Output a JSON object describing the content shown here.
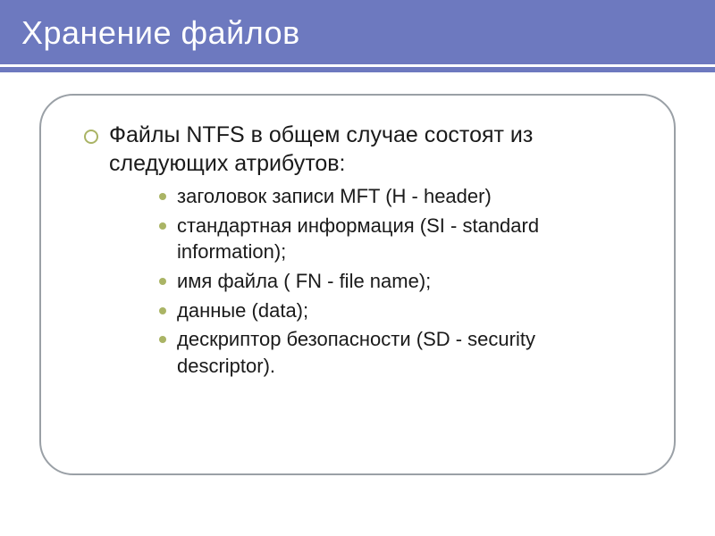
{
  "header": {
    "title": "Хранение файлов"
  },
  "content": {
    "main_item": "Файлы NTFS в общем случае состоят из следующих атрибутов:",
    "sub_items": [
      "заголовок записи MFT (H - header)",
      "стандартная информация (SI - standard information);",
      "имя файла ( FN - file name);",
      "данные (data);",
      "дескриптор безопасности (SD - security descriptor)."
    ]
  }
}
